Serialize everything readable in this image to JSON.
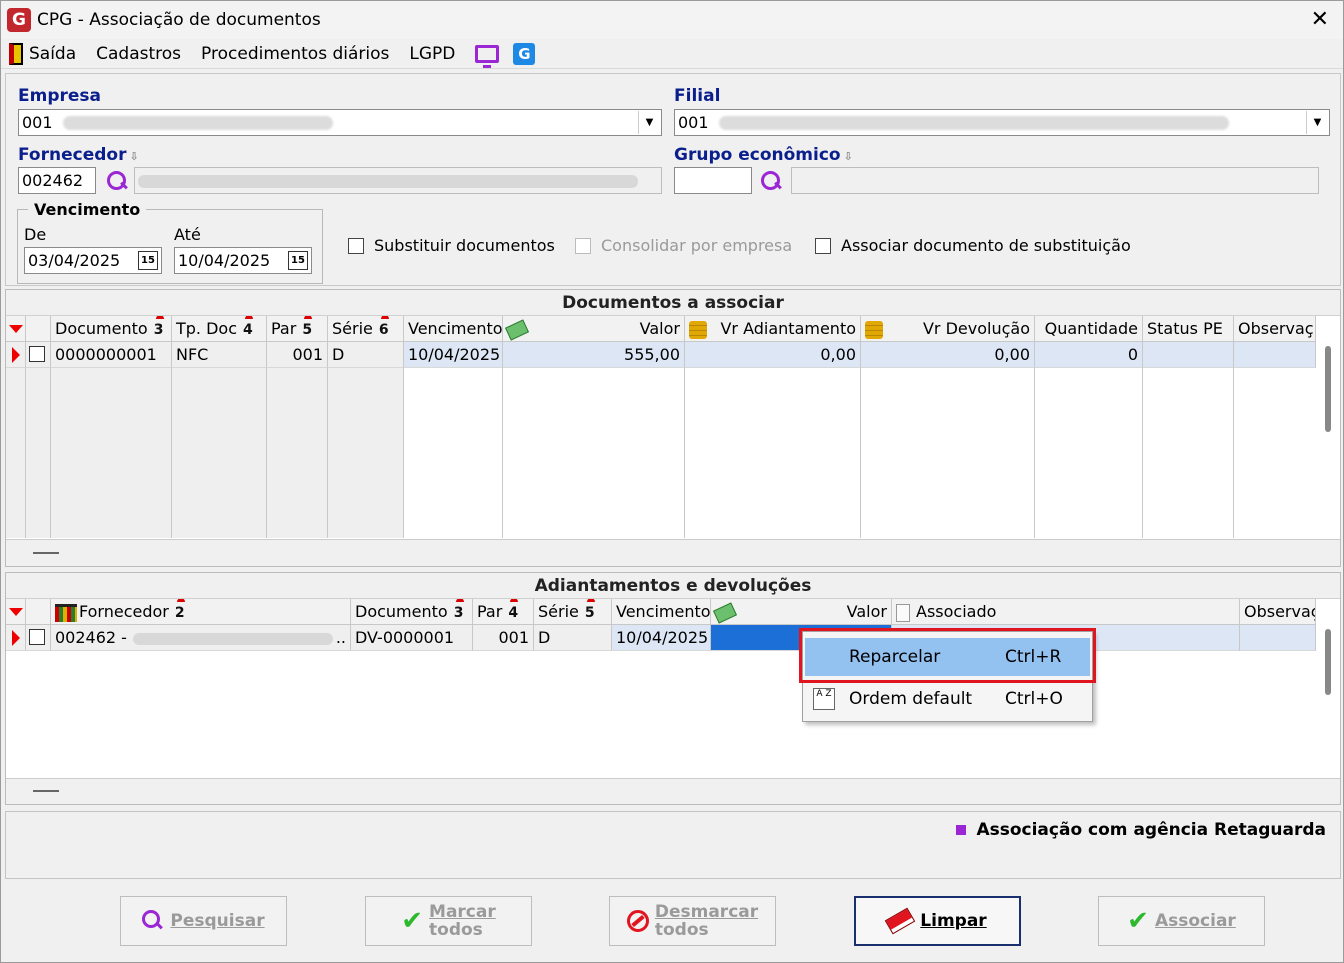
{
  "window": {
    "title": "CPG - Associação de documentos",
    "close": "✕",
    "app_icon": "G"
  },
  "menu": {
    "exit": "Saída",
    "cadastros": "Cadastros",
    "procedimentos": "Procedimentos diários",
    "lgpd": "LGPD",
    "g": "G"
  },
  "filters": {
    "empresa_label": "Empresa",
    "empresa_code": "001",
    "filial_label": "Filial",
    "filial_code": "001",
    "fornecedor_label": "Fornecedor",
    "fornecedor_code": "002462",
    "grupo_label": "Grupo econômico",
    "grupo_code": "",
    "vencimento_label": "Vencimento",
    "de_label": "De",
    "de_value": "03/04/2025",
    "ate_label": "Até",
    "ate_value": "10/04/2025",
    "cal_glyph": "15",
    "sort_arrow": "⇩",
    "substituir": "Substituir documentos",
    "consolidar": "Consolidar por empresa",
    "associar_subst": "Associar documento de substituição"
  },
  "docs": {
    "title": "Documentos a associar",
    "columns": {
      "documento": "Documento",
      "documento_n": "3",
      "tpdoc": "Tp. Doc",
      "tpdoc_n": "4",
      "par": "Par",
      "par_n": "5",
      "serie": "Série",
      "serie_n": "6",
      "vencimento": "Vencimento",
      "valor": "Valor",
      "vr_adiant": "Vr Adiantamento",
      "vr_devol": "Vr Devolução",
      "quantidade": "Quantidade",
      "status_pe": "Status PE",
      "observ": "Observaç"
    },
    "row": {
      "documento": "0000000001",
      "tpdoc": "NFC",
      "par": "001",
      "serie": "D",
      "vencimento": "10/04/2025",
      "valor": "555,00",
      "vr_adiant": "0,00",
      "vr_devol": "0,00",
      "quantidade": "0"
    }
  },
  "adiant": {
    "title": "Adiantamentos e devoluções",
    "columns": {
      "fornecedor": "Fornecedor",
      "fornecedor_n": "2",
      "documento": "Documento",
      "documento_n": "3",
      "par": "Par",
      "par_n": "4",
      "serie": "Série",
      "serie_n": "5",
      "vencimento": "Vencimento",
      "valor": "Valor",
      "associado": "Associado",
      "observ": "Observaç"
    },
    "row": {
      "fornecedor": "002462 -",
      "ellipsis": "..",
      "documento": "DV-0000001",
      "par": "001",
      "serie": "D",
      "vencimento": "10/04/2025"
    }
  },
  "context_menu": {
    "reparcelar": "Reparcelar",
    "reparcelar_key": "Ctrl+R",
    "ordem": "Ordem default",
    "ordem_key": "Ctrl+O",
    "az_icon": "A Z"
  },
  "legend": {
    "text": "Associação com agência Retaguarda"
  },
  "buttons": {
    "pesquisar": "Pesquisar",
    "marcar_1": "Marcar",
    "marcar_2": "todos",
    "desmarcar_1": "Desmarcar",
    "desmarcar_2": "todos",
    "limpar": "Limpar",
    "associar": "Associar"
  },
  "colors": {
    "accent": "#9b26d4",
    "label": "#0b1f8c",
    "highlight": "#93c1f0",
    "callout": "#e0151f"
  }
}
